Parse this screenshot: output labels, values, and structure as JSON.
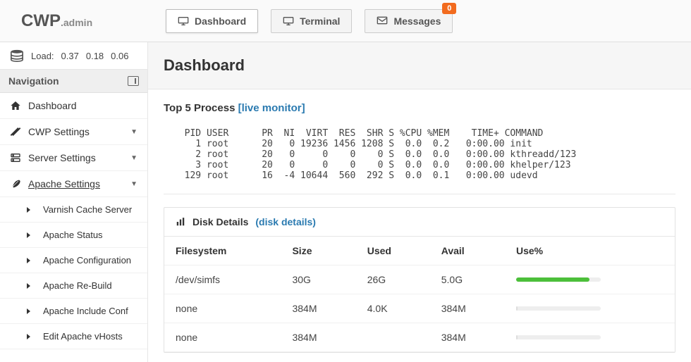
{
  "brand": {
    "main": "CWP",
    "sub": ".admin"
  },
  "tabs": {
    "dashboard": "Dashboard",
    "terminal": "Terminal",
    "messages": "Messages",
    "messages_badge": "0"
  },
  "load": {
    "label": "Load:",
    "v1": "0.37",
    "v2": "0.18",
    "v3": "0.06"
  },
  "nav": {
    "heading": "Navigation",
    "items": [
      {
        "label": "Dashboard"
      },
      {
        "label": "CWP Settings"
      },
      {
        "label": "Server Settings"
      },
      {
        "label": "Apache Settings"
      }
    ],
    "apache_sub": [
      "Varnish Cache Server",
      "Apache Status",
      "Apache Configuration",
      "Apache Re-Build",
      "Apache Include Conf",
      "Edit Apache vHosts"
    ]
  },
  "page": {
    "title": "Dashboard"
  },
  "top5": {
    "heading": "Top 5 Process ",
    "link": "[live monitor]",
    "header": "  PID USER      PR  NI  VIRT  RES  SHR S %CPU %MEM    TIME+ COMMAND",
    "rows": [
      "    1 root      20   0 19236 1456 1208 S  0.0  0.2   0:00.00 init",
      "    2 root      20   0     0    0    0 S  0.0  0.0   0:00.00 kthreadd/123",
      "    3 root      20   0     0    0    0 S  0.0  0.0   0:00.00 khelper/123",
      "  129 root      16  -4 10644  560  292 S  0.0  0.1   0:00.00 udevd"
    ]
  },
  "disk": {
    "heading": "Disk Details ",
    "link": "(disk details)",
    "cols": {
      "fs": "Filesystem",
      "size": "Size",
      "used": "Used",
      "avail": "Avail",
      "use": "Use%"
    },
    "rows": [
      {
        "fs": "/dev/simfs",
        "size": "30G",
        "used": "26G",
        "avail": "5.0G",
        "use_pct": 87
      },
      {
        "fs": "none",
        "size": "384M",
        "used": "4.0K",
        "avail": "384M",
        "use_pct": 1
      },
      {
        "fs": "none",
        "size": "384M",
        "used": "",
        "avail": "384M",
        "use_pct": 1
      }
    ]
  }
}
